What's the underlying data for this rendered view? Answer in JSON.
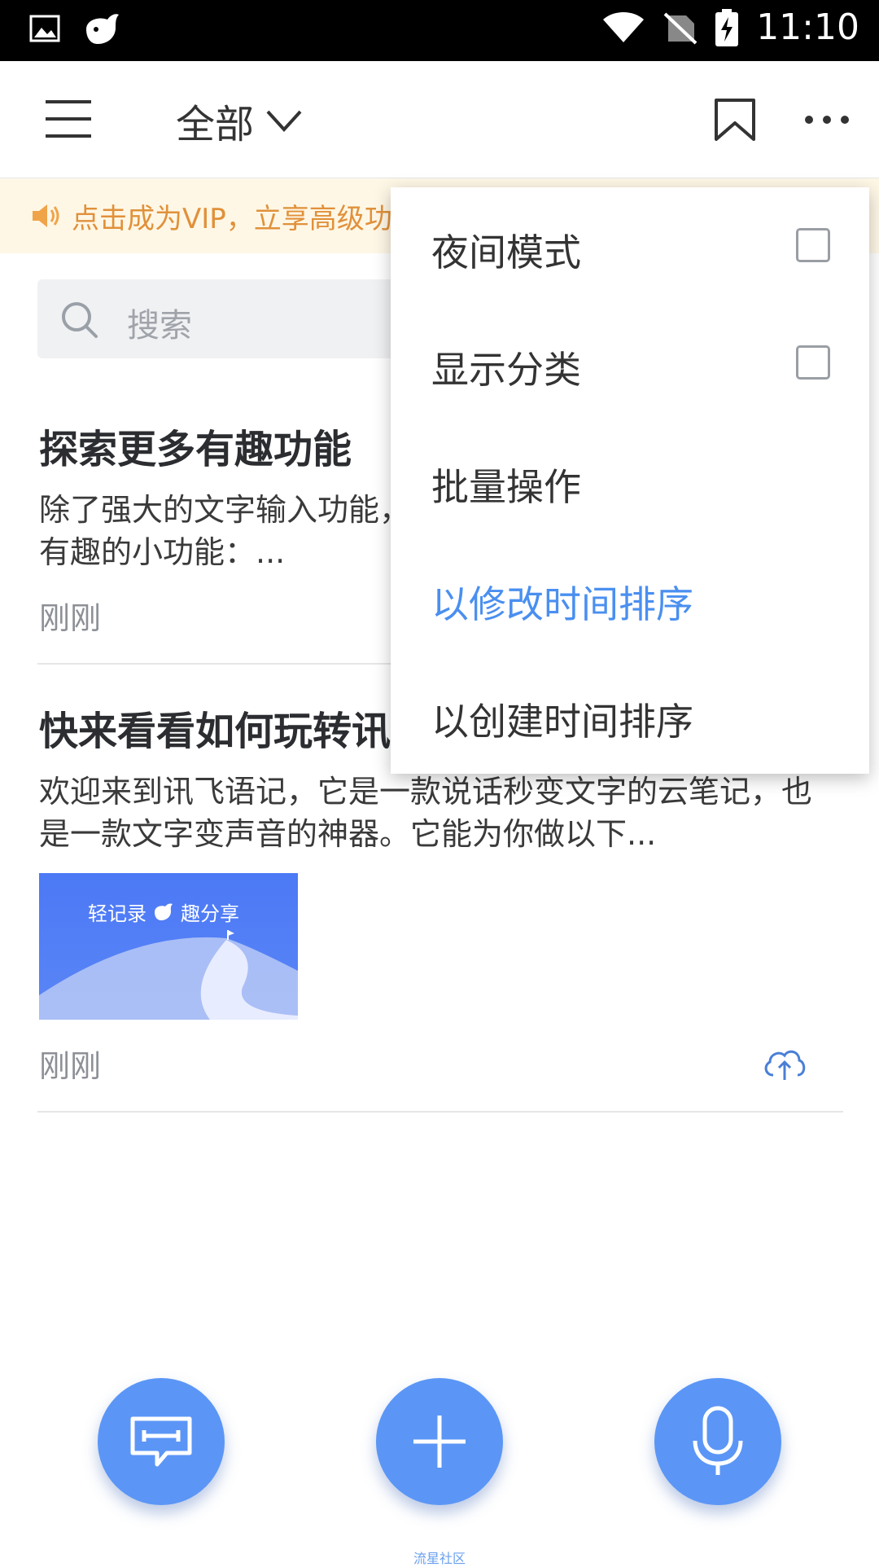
{
  "status_bar": {
    "time": "11:10"
  },
  "header": {
    "title": "全部"
  },
  "vip_banner": {
    "text": "点击成为VIP，立享高级功"
  },
  "search": {
    "placeholder": "搜索"
  },
  "notes": [
    {
      "title": "探索更多有趣功能",
      "body": "除了强大的文字输入功能，还有很多\n有趣的小功能：...",
      "time": "刚刚"
    },
    {
      "title": "快来看看如何玩转讯飞语记",
      "body": "欢迎来到讯飞语记，它是一款说话秒变文字的云笔记，也是一款文字变声音的神器。它能为你做以下...",
      "time": "刚刚",
      "thumb_caption_left": "轻记录",
      "thumb_caption_right": "趣分享"
    }
  ],
  "dropdown": {
    "items": [
      {
        "label": "夜间模式",
        "checkbox": true,
        "checked": false
      },
      {
        "label": "显示分类",
        "checkbox": true,
        "checked": false
      },
      {
        "label": "批量操作"
      },
      {
        "label": "以修改时间排序",
        "selected": true
      },
      {
        "label": "以创建时间排序"
      }
    ]
  },
  "footer_watermark": "流星社区",
  "colors": {
    "accent": "#5b96f6",
    "selected_text": "#4a8ff0",
    "vip_text": "#e0913a",
    "vip_bg": "#fff7e6"
  }
}
